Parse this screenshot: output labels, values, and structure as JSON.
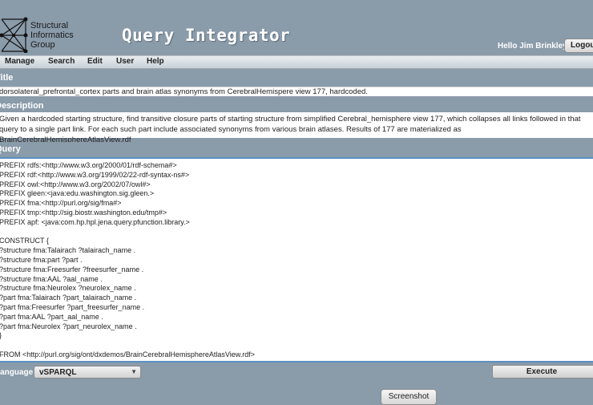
{
  "header": {
    "logo_text": [
      "Structural",
      "Informatics",
      "Group"
    ],
    "app_title": "Query Integrator",
    "greeting": "Hello Jim Brinkley",
    "logout_label": "Logout"
  },
  "menu": {
    "items": [
      "Manage",
      "Search",
      "Edit",
      "User",
      "Help"
    ]
  },
  "sections": {
    "title_label": "Title",
    "description_label": "Description",
    "query_label": "Query"
  },
  "title_value": "dorsolateral_prefrontal_cortex parts and brain atlas synonyms from CerebralHemispere view 177, hardcoded.",
  "description_value": "Given a hardcoded starting structure, find transitive closure parts of starting structure from simplified Cerebral_hemisphere view 177, which  collapses all links followed in that query to a single part link. For each such part include associated synonyms from various brain atlases. Results of 177 are materialized as BrainCerebralHemisphereAtlasView.rdf",
  "query_lines": [
    "PREFIX rdfs:<http://www.w3.org/2000/01/rdf-schema#>",
    "PREFIX rdf:<http://www.w3.org/1999/02/22-rdf-syntax-ns#>",
    "PREFIX owl:<http://www.w3.org/2002/07/owl#>",
    "PREFIX gleen:<java:edu.washington.sig.gleen.>",
    "PREFIX fma:<http://purl.org/sig/fma#>",
    "PREFIX tmp:<http://sig.biostr.washington.edu/tmp#>",
    "PREFIX apf: <java:com.hp.hpl.jena.query.pfunction.library.>",
    "",
    "CONSTRUCT {",
    "?structure fma:Talairach ?talairach_name .",
    "?structure fma:part ?part .",
    "?structure fma:Freesurfer ?freesurfer_name .",
    "?structure fma:AAL ?aal_name .",
    "?structure fma:Neurolex ?neurolex_name .",
    "?part fma:Talairach ?part_talairach_name .",
    "?part fma:Freesurfer ?part_freesurfer_name .",
    "?part fma:AAL ?part_aal_name .",
    "?part fma:Neurolex ?part_neurolex_name .",
    "}",
    "",
    "FROM <http://purl.org/sig/ont/dxdemos/BrainCerebralHemisphereAtlasView.rdf>"
  ],
  "language": {
    "label": "Language",
    "selected": "vSPARQL"
  },
  "buttons": {
    "execute": "Execute",
    "screenshot": "Screenshot"
  },
  "icons": {
    "logo": "network-graph-logo-icon",
    "dropdown": "chevron-down-icon"
  }
}
